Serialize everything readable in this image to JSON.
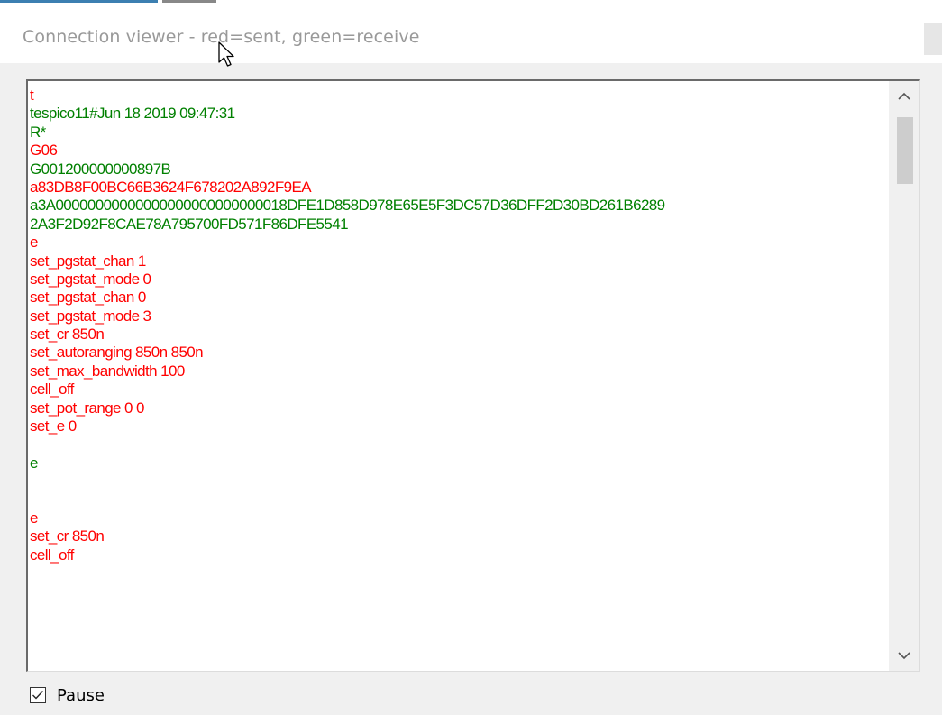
{
  "window": {
    "title": "Connection viewer - red=sent, green=receive"
  },
  "log": {
    "lines": [
      {
        "text": "t",
        "dir": "sent"
      },
      {
        "text": "tespico11#Jun 18 2019 09:47:31",
        "dir": "receive"
      },
      {
        "text": "R*",
        "dir": "receive"
      },
      {
        "text": "G06",
        "dir": "sent"
      },
      {
        "text": "G001200000000897B",
        "dir": "receive"
      },
      {
        "text": "a83DB8F00BC66B3624F678202A892F9EA",
        "dir": "sent"
      },
      {
        "text": "a3A00000000000000000000000000018DFE1D858D978E65E5F3DC57D36DFF2D30BD261B6289",
        "dir": "receive"
      },
      {
        "text": "2A3F2D92F8CAE78A795700FD571F86DFE5541",
        "dir": "receive"
      },
      {
        "text": "e",
        "dir": "sent"
      },
      {
        "text": "set_pgstat_chan 1",
        "dir": "sent"
      },
      {
        "text": "set_pgstat_mode 0",
        "dir": "sent"
      },
      {
        "text": "set_pgstat_chan 0",
        "dir": "sent"
      },
      {
        "text": "set_pgstat_mode 3",
        "dir": "sent"
      },
      {
        "text": "set_cr 850n",
        "dir": "sent"
      },
      {
        "text": "set_autoranging 850n 850n",
        "dir": "sent"
      },
      {
        "text": "set_max_bandwidth 100",
        "dir": "sent"
      },
      {
        "text": "cell_off",
        "dir": "sent"
      },
      {
        "text": "set_pot_range 0 0",
        "dir": "sent"
      },
      {
        "text": "set_e 0",
        "dir": "sent"
      },
      {
        "text": "",
        "dir": "sent"
      },
      {
        "text": "e",
        "dir": "receive"
      },
      {
        "text": "",
        "dir": "receive"
      },
      {
        "text": "",
        "dir": "receive"
      },
      {
        "text": "e",
        "dir": "sent"
      },
      {
        "text": "set_cr 850n",
        "dir": "sent"
      },
      {
        "text": "cell_off",
        "dir": "sent"
      }
    ],
    "colors": {
      "sent": "#ff0000",
      "receive": "#008000"
    }
  },
  "scrollbar": {
    "up_icon": "chevron-up-icon",
    "down_icon": "chevron-down-icon"
  },
  "pause": {
    "label": "Pause",
    "checked": true
  }
}
